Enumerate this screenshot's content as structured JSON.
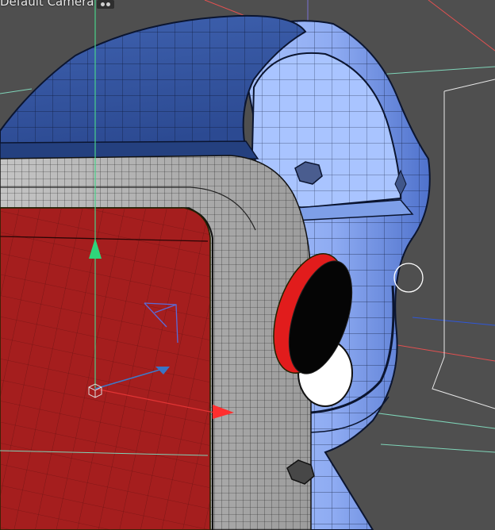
{
  "viewport": {
    "camera_label": "Default Camera"
  },
  "colors": {
    "background": "#4f4f4f",
    "body_blue_dark": "#2f4f96",
    "body_blue_light": "#93b3f7",
    "frame_gray": "#bdbdbd",
    "face_red": "#a61f1f",
    "lens_red": "#e21d1d",
    "axis_green": "#2ecc71",
    "axis_red": "#e23030",
    "axis_blue": "#3a6fc0",
    "wire": "#0b1530",
    "selection_outline": "#ffffff"
  },
  "icons": [
    "camera-icon",
    "gizmo-x-arrow-icon",
    "gizmo-y-arrow-icon",
    "gizmo-z-arrow-icon",
    "gizmo-center-cube-icon",
    "light-object-icon",
    "cursor-circle-icon"
  ]
}
